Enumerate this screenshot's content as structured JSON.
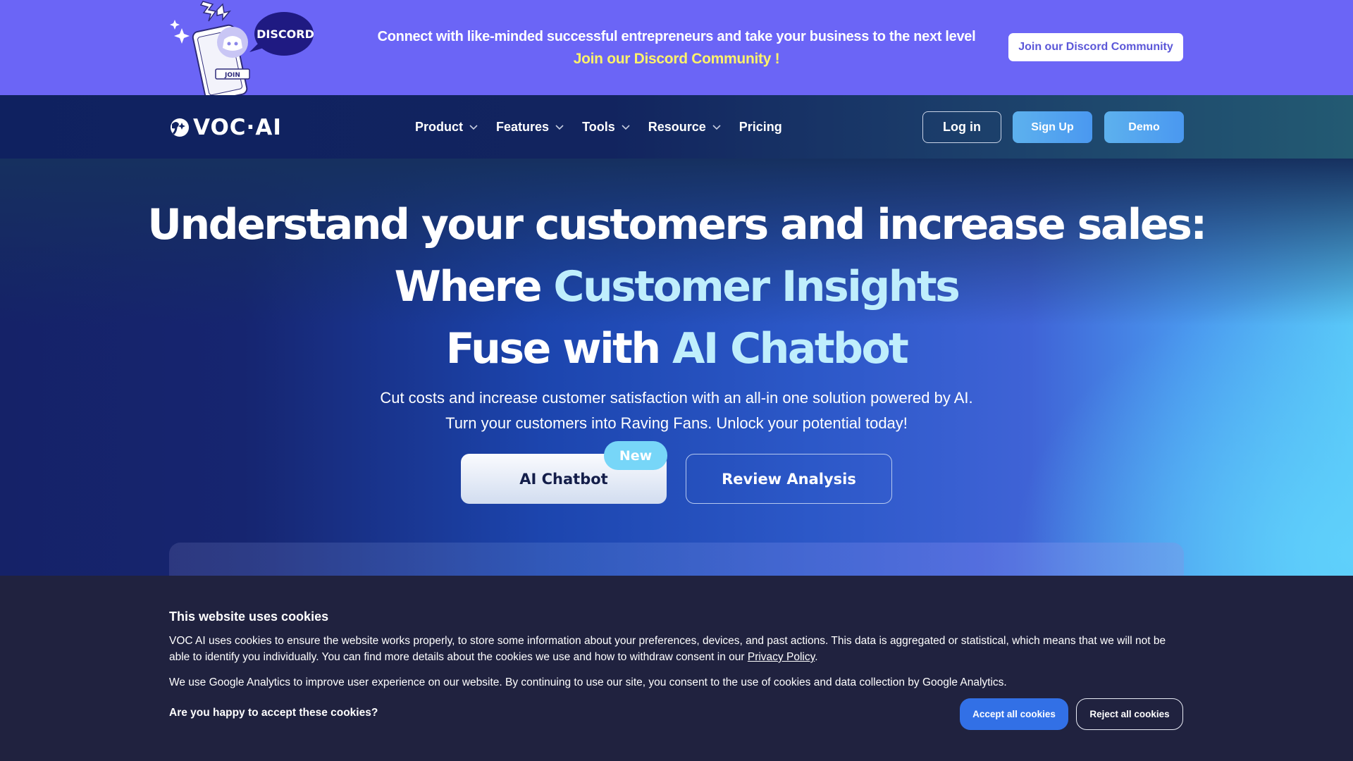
{
  "discord_banner": {
    "art_label": "DISCORD",
    "art_join": "JOIN",
    "line1": "Connect with like-minded successful entrepreneurs and take your business to the next level",
    "line2": "Join our Discord Community !",
    "button_label": "Join our Discord Community",
    "colors": {
      "background": "#6b65f6",
      "highlight": "#fef26a"
    }
  },
  "nav": {
    "logo_text": "VOC·AI",
    "items": [
      {
        "label": "Product",
        "has_dropdown": true
      },
      {
        "label": "Features",
        "has_dropdown": true
      },
      {
        "label": "Tools",
        "has_dropdown": true
      },
      {
        "label": "Resource",
        "has_dropdown": true
      },
      {
        "label": "Pricing",
        "has_dropdown": false
      }
    ],
    "login_label": "Log in",
    "signup_label": "Sign Up",
    "demo_label": "Demo"
  },
  "hero": {
    "headline_line1": "Understand your customers and increase sales:",
    "headline_line2_prefix": "Where ",
    "headline_line2_accent": "Customer Insights",
    "headline_line3_prefix": "Fuse with ",
    "headline_line3_accent": "AI Chatbot",
    "subtitle_line1": "Cut costs and increase customer satisfaction with an all-in one solution powered by AI.",
    "subtitle_line2": "Turn your customers into Raving Fans. Unlock your potential today!",
    "cta_primary": "AI Chatbot",
    "cta_badge": "New",
    "cta_secondary": "Review Analysis",
    "colors": {
      "accent_text": "#bfeefc",
      "badge": "#77d6f8"
    }
  },
  "cookie_banner": {
    "title": "This website uses cookies",
    "text1_before_link": "VOC AI uses cookies to ensure the website works properly, to store some information about your preferences, devices, and past actions. This data is aggregated or statistical, which means that we will not be able to identify you individually. You can find more details about the cookies we use and how to withdraw consent in our ",
    "text1_link": "Privacy Policy",
    "text1_after_link": ".",
    "text2": "We use Google Analytics to improve user experience on our website. By continuing to use our site, you consent to the use of cookies and data collection by Google Analytics.",
    "question": "Are you happy to accept these cookies?",
    "accept_label": "Accept all cookies",
    "reject_label": "Reject all cookies",
    "colors": {
      "background": "#20223f",
      "accept": "#3270e6"
    }
  }
}
